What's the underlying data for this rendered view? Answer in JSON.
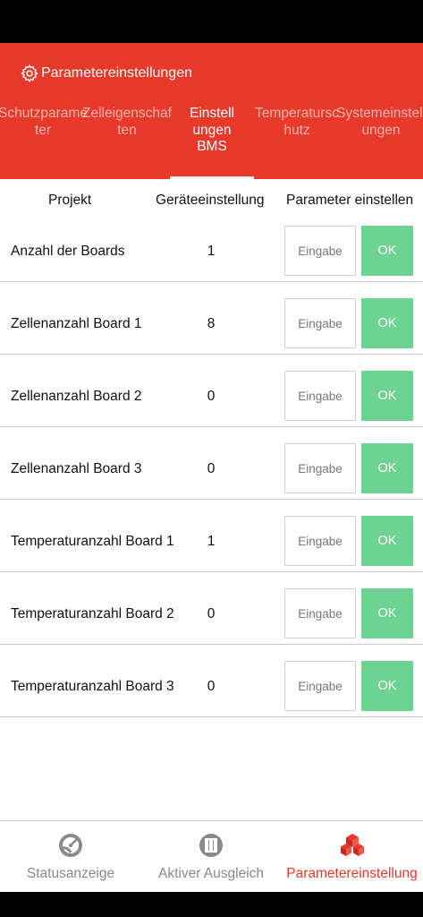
{
  "header": {
    "title": "Parametereinstellungen",
    "icon": "gear-icon",
    "tabs": [
      {
        "label": "Schutzparameter",
        "active": false
      },
      {
        "label": "Zelleigenschaften",
        "active": false
      },
      {
        "label": "Einstellungen BMS",
        "active": true
      },
      {
        "label": "Temperaturschutz",
        "active": false
      },
      {
        "label": "Systemeinstellungen",
        "active": false
      }
    ]
  },
  "table": {
    "columns": [
      "Projekt",
      "Geräteeinstellung",
      "Parameter einstellen"
    ],
    "input_placeholder": "Eingabe",
    "ok_label": "OK",
    "rows": [
      {
        "name": "Anzahl der Boards",
        "value": "1"
      },
      {
        "name": "Zellenanzahl Board 1",
        "value": "8"
      },
      {
        "name": "Zellenanzahl Board 2",
        "value": "0"
      },
      {
        "name": "Zellenanzahl Board 3",
        "value": "0"
      },
      {
        "name": "Temperaturanzahl Board 1",
        "value": "1"
      },
      {
        "name": "Temperaturanzahl Board 2",
        "value": "0"
      },
      {
        "name": "Temperaturanzahl Board 3",
        "value": "0"
      }
    ]
  },
  "bottom_nav": [
    {
      "label": "Statusanzeige",
      "icon": "status-gauge-icon",
      "active": false
    },
    {
      "label": "Aktiver Ausgleich",
      "icon": "balance-icon",
      "active": false
    },
    {
      "label": "Parametereinstellung",
      "icon": "cubes-icon",
      "active": true
    }
  ],
  "colors": {
    "accent": "#e8392b",
    "ok_button": "#6dd392",
    "inactive_nav": "#888888"
  }
}
